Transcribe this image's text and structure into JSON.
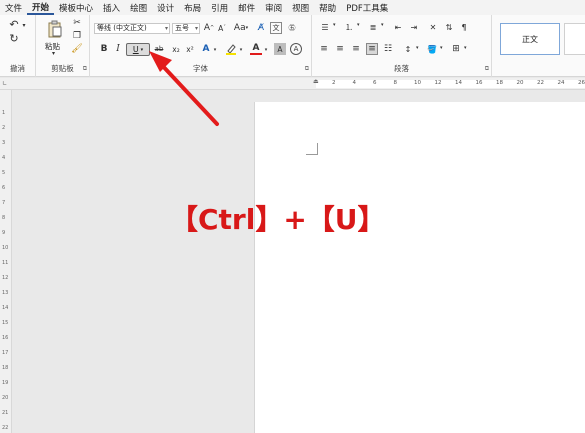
{
  "menu": [
    "文件",
    "开始",
    "模板中心",
    "插入",
    "绘图",
    "设计",
    "布局",
    "引用",
    "邮件",
    "审阅",
    "视图",
    "帮助",
    "PDF工具集"
  ],
  "active_menu": "开始",
  "ribbon": {
    "undo_group": {
      "label": "撤消"
    },
    "clipboard_group": {
      "label": "剪贴板",
      "paste_label": "粘贴"
    },
    "font_group": {
      "label": "字体",
      "font_name": "等线 (中文正文)",
      "font_size": "五号",
      "bold": "B",
      "italic": "I",
      "underline": "U",
      "strikethrough": "ab",
      "subscript": "x₂",
      "superscript": "x²",
      "text_effects": "A",
      "font_color": "A",
      "grow_font": "A",
      "shrink_font": "A",
      "change_case": "Aa",
      "char_shading": "A",
      "char_border": "A",
      "phonetic": "文"
    },
    "paragraph_group": {
      "label": "段落"
    },
    "styles": {
      "normal": "正文"
    }
  },
  "ruler_numbers": [
    "2",
    "4",
    "6",
    "8",
    "10",
    "12",
    "14",
    "16",
    "18",
    "20",
    "22",
    "24",
    "26"
  ],
  "vruler_numbers": [
    "1",
    "2",
    "3",
    "4",
    "5",
    "6",
    "7",
    "8",
    "9",
    "10",
    "11",
    "12",
    "13",
    "14",
    "15",
    "16",
    "17",
    "18",
    "19",
    "20",
    "21",
    "22"
  ],
  "caption": "【Ctrl】+【U】",
  "colors": {
    "accent": "#d81818",
    "ribbon_bg": "#fafafa",
    "workspace": "#e9e9e9"
  }
}
